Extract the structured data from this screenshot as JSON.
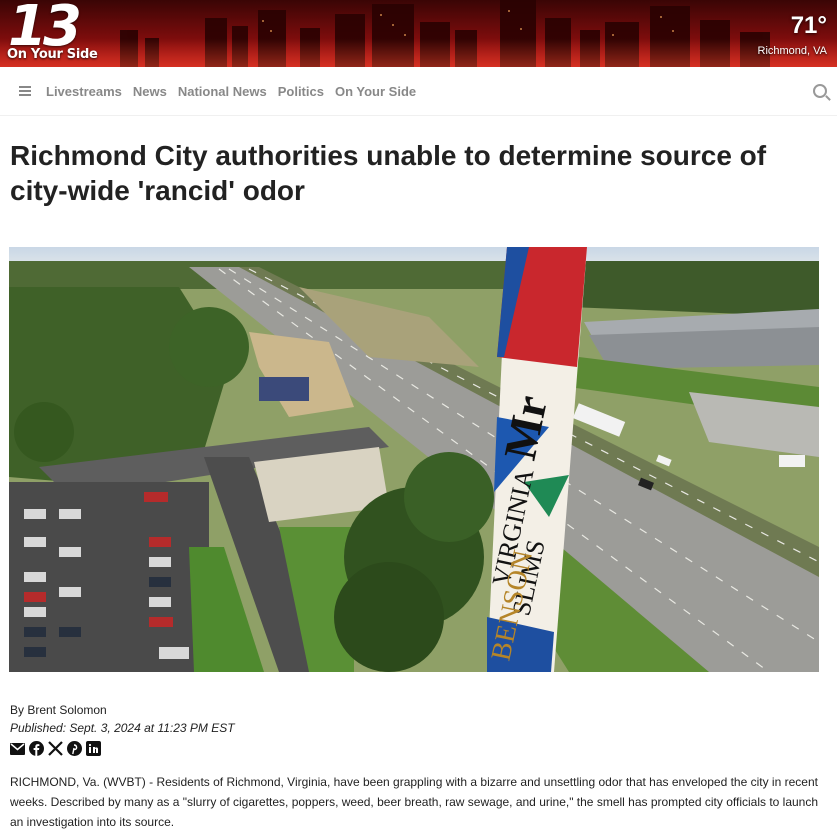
{
  "header": {
    "logo_number": "13",
    "logo_tagline": "On Your Side",
    "temperature": "71°",
    "location": "Richmond, VA"
  },
  "nav": {
    "items": [
      "Livestreams",
      "News",
      "National News",
      "Politics",
      "On Your Side"
    ],
    "icons": [
      "hamburger-menu-icon",
      "search-icon"
    ]
  },
  "article": {
    "headline": "Richmond City authorities unable to determine source of city-wide 'rancid' odor",
    "byline": "By Brent Solomon",
    "published": "Published: Sept. 3, 2024 at 11:23 PM EST",
    "share_icons": [
      "email-icon",
      "facebook-icon",
      "x-icon",
      "pinterest-icon",
      "linkedin-icon"
    ],
    "body": "RICHMOND, Va. (WVBT) - Residents of Richmond, Virginia, have been grappling with a bizarre and unsettling odor that has enveloped the city in recent weeks. Described by many as a \"slurry of cigarettes, poppers, weed, beer breath, raw sewage, and urine,\" the smell has prompted city officials to launch an investigation into its source."
  },
  "photo": {
    "tower_text": [
      "Mr",
      "VIRGINIA",
      "SLIMS",
      "BENSON"
    ]
  },
  "colors": {
    "banner_red": "#b31515",
    "nav_text": "#888888",
    "headline": "#222222"
  }
}
